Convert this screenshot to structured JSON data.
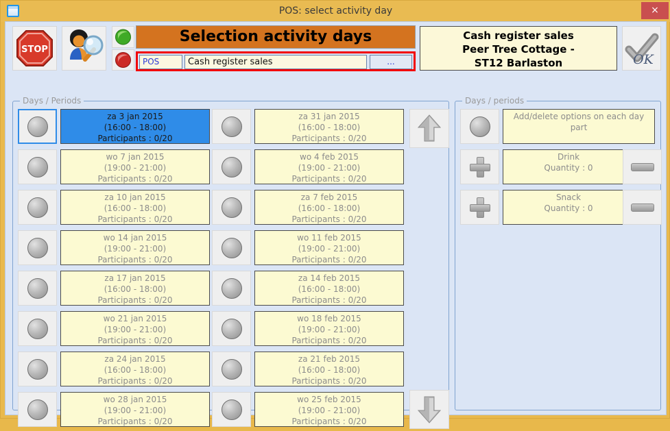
{
  "window": {
    "title": "POS: select activity day",
    "icon": "window-icon",
    "close_label": "×"
  },
  "toolbar": {
    "stop_icon": "stop-sign-icon",
    "user_search_icon": "user-magnifier-icon",
    "green_icon": "green-light-icon",
    "red_icon": "red-light-icon",
    "ok_label": "OK",
    "ok_icon": "checkmark-ok-icon"
  },
  "header": {
    "banner": "Selection activity days",
    "pos_label": "POS",
    "pos_value": "Cash register sales",
    "browse_label": "...",
    "info_lines": [
      "Cash register sales",
      "Peer Tree Cottage -",
      "ST12 Barlaston"
    ]
  },
  "left_panel": {
    "group_title": "Days / Periods",
    "scroll_up_icon": "arrow-up-icon",
    "scroll_down_icon": "arrow-down-icon",
    "column1": [
      {
        "date": "za 3 jan 2015",
        "time": "(16:00 - 18:00)",
        "participants": "Participants : 0/20",
        "selected": true
      },
      {
        "date": "wo 7 jan 2015",
        "time": "(19:00 - 21:00)",
        "participants": "Participants : 0/20",
        "selected": false
      },
      {
        "date": "za 10 jan 2015",
        "time": "(16:00 - 18:00)",
        "participants": "Participants : 0/20",
        "selected": false
      },
      {
        "date": "wo 14 jan 2015",
        "time": "(19:00 - 21:00)",
        "participants": "Participants : 0/20",
        "selected": false
      },
      {
        "date": "za 17 jan 2015",
        "time": "(16:00 - 18:00)",
        "participants": "Participants : 0/20",
        "selected": false
      },
      {
        "date": "wo 21 jan 2015",
        "time": "(19:00 - 21:00)",
        "participants": "Participants : 0/20",
        "selected": false
      },
      {
        "date": "za 24 jan 2015",
        "time": "(16:00 - 18:00)",
        "participants": "Participants : 0/20",
        "selected": false
      },
      {
        "date": "wo 28 jan 2015",
        "time": "(19:00 - 21:00)",
        "participants": "Participants : 0/20",
        "selected": false
      }
    ],
    "column2": [
      {
        "date": "za 31 jan 2015",
        "time": "(16:00 - 18:00)",
        "participants": "Participants : 0/20",
        "selected": false
      },
      {
        "date": "wo 4 feb 2015",
        "time": "(19:00 - 21:00)",
        "participants": "Participants : 0/20",
        "selected": false
      },
      {
        "date": "za 7 feb 2015",
        "time": "(16:00 - 18:00)",
        "participants": "Participants : 0/20",
        "selected": false
      },
      {
        "date": "wo 11 feb 2015",
        "time": "(19:00 - 21:00)",
        "participants": "Participants : 0/20",
        "selected": false
      },
      {
        "date": "za 14 feb 2015",
        "time": "(16:00 - 18:00)",
        "participants": "Participants : 0/20",
        "selected": false
      },
      {
        "date": "wo 18 feb 2015",
        "time": "(19:00 - 21:00)",
        "participants": "Participants : 0/20",
        "selected": false
      },
      {
        "date": "za 21 feb 2015",
        "time": "(16:00 - 18:00)",
        "participants": "Participants : 0/20",
        "selected": false
      },
      {
        "date": "wo 25 feb 2015",
        "time": "(19:00 - 21:00)",
        "participants": "Participants : 0/20",
        "selected": false
      }
    ]
  },
  "right_panel": {
    "group_title": "Days / periods",
    "header_row": {
      "line1": "Add/delete options on each day",
      "line2": "part"
    },
    "options": [
      {
        "name": "Drink",
        "quantity": "Quantity : 0",
        "add_icon": "plus-icon",
        "remove_icon": "minus-icon"
      },
      {
        "name": "Snack",
        "quantity": "Quantity : 0",
        "add_icon": "plus-icon",
        "remove_icon": "minus-icon"
      }
    ]
  },
  "colors": {
    "window_frame": "#e9bb52",
    "client_bg": "#dbe5f5",
    "banner_bg": "#d4731f",
    "cell_bg": "#fcfad2",
    "selected_bg": "#2f8ce8",
    "close_bg": "#c94f4f",
    "field_highlight": "#f20000"
  }
}
